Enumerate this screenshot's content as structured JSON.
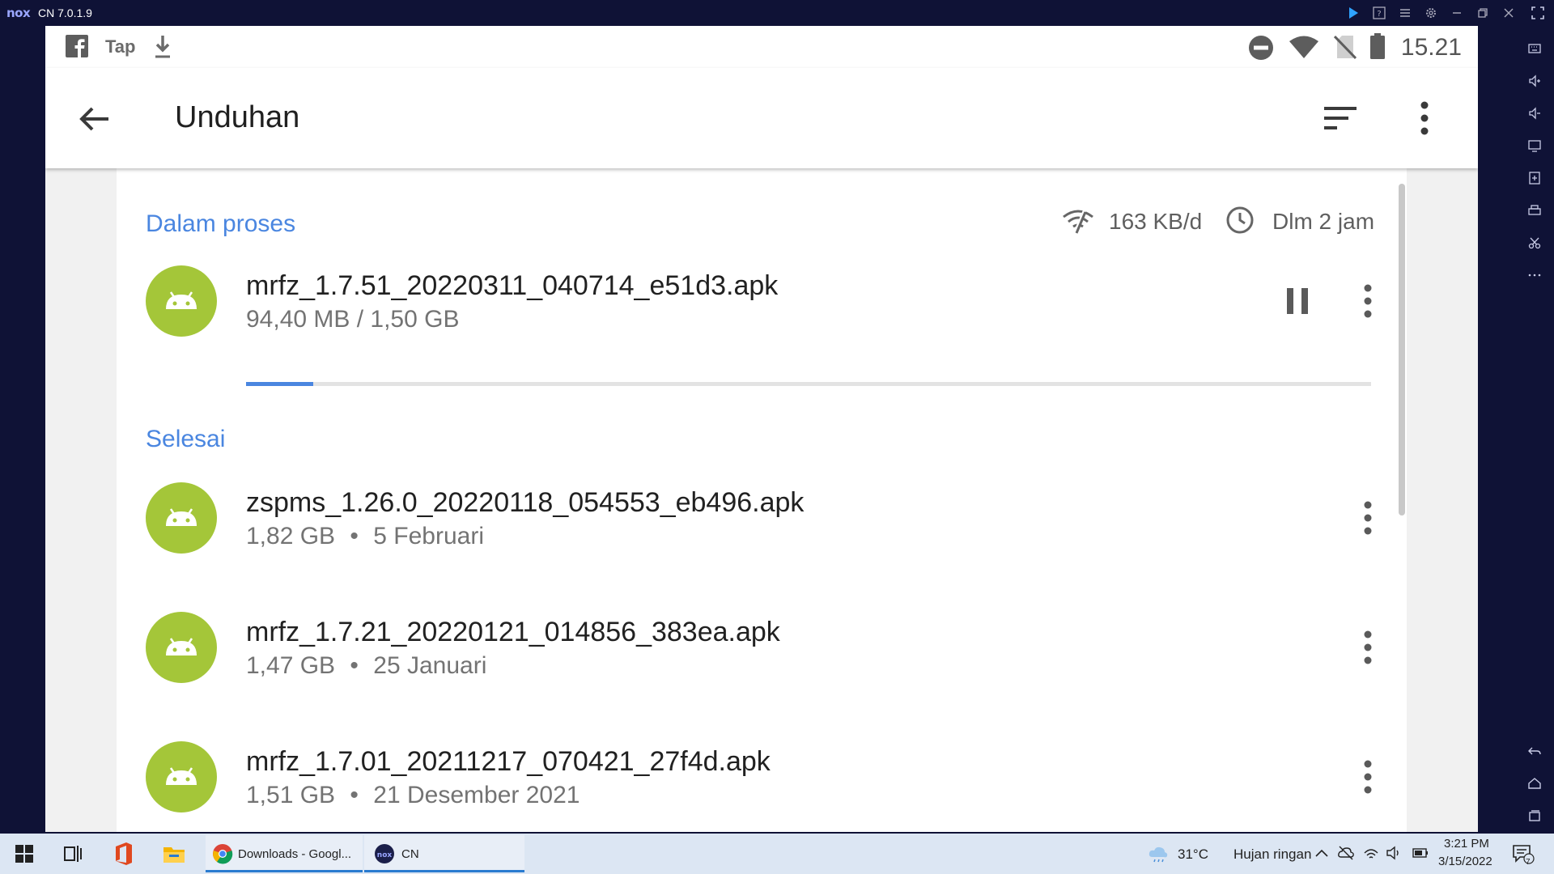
{
  "emulator": {
    "logo": "nox",
    "version": "CN 7.0.1.9",
    "accent_color": "#2fa3ff",
    "titlebar_icons": [
      "play-store-icon",
      "help-icon",
      "menu-icon",
      "settings-icon",
      "minimize-icon",
      "restore-icon",
      "close-icon",
      "fullscreen-icon"
    ],
    "sidebar_icons": [
      "keyboard-icon",
      "volume-up-icon",
      "volume-down-icon",
      "screen-icon",
      "add-apk-icon",
      "print-icon",
      "scissors-icon",
      "more-icon",
      "back-nav-icon",
      "home-nav-icon",
      "recents-nav-icon"
    ]
  },
  "status_bar": {
    "left_icons": [
      "facebook-icon",
      "tap-icon",
      "download-icon"
    ],
    "tap_label": "Tap",
    "right_icons": [
      "do-not-disturb-icon",
      "wifi-icon",
      "no-sim-icon",
      "battery-icon"
    ],
    "time": "15.21"
  },
  "app_bar": {
    "title": "Unduhan",
    "icons": [
      "back-arrow-icon",
      "sort-icon",
      "overflow-menu-icon"
    ]
  },
  "in_progress": {
    "header": "Dalam proses",
    "speed": "163 KB/d",
    "eta": "Dlm 2 jam",
    "item": {
      "name": "mrfz_1.7.51_20220311_040714_e51d3.apk",
      "progress_text": "94,40 MB / 1,50 GB",
      "progress_fraction": 0.06
    }
  },
  "completed": {
    "header": "Selesai",
    "items": [
      {
        "name": "zspms_1.26.0_20220118_054553_eb496.apk",
        "size": "1,82 GB",
        "date": "5 Februari"
      },
      {
        "name": "mrfz_1.7.21_20220121_014856_383ea.apk",
        "size": "1,47 GB",
        "date": "25 Januari"
      },
      {
        "name": "mrfz_1.7.01_20211217_070421_27f4d.apk",
        "size": "1,51 GB",
        "date": "21 Desember 2021"
      }
    ],
    "separator": "•"
  },
  "colors": {
    "accent_blue": "#4a86e0",
    "android_green": "#a4c639",
    "emulator_bg": "#0f1236"
  },
  "taskbar": {
    "apps": [
      {
        "label": "Downloads - Googl...",
        "icon": "chrome-icon"
      },
      {
        "label": "CN",
        "icon": "nox-icon"
      }
    ],
    "weather": {
      "temp": "31°C",
      "desc": "Hujan ringan"
    },
    "time": "3:21 PM",
    "date": "3/15/2022",
    "notification_count": "7"
  }
}
